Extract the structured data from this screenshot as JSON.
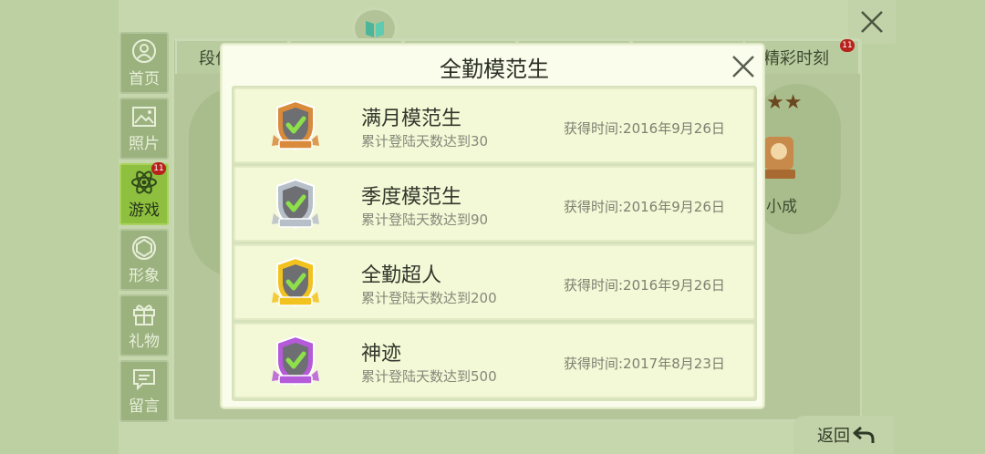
{
  "background": {
    "tabs": [
      "段位",
      "精彩时刻"
    ],
    "tab_badge": "11",
    "achievement_label": "小成"
  },
  "nav": {
    "items": [
      {
        "label": "首页",
        "icon": "home-icon"
      },
      {
        "label": "照片",
        "icon": "photo-icon"
      },
      {
        "label": "游戏",
        "icon": "atom-icon",
        "badge": "11"
      },
      {
        "label": "形象",
        "icon": "avatar-icon"
      },
      {
        "label": "礼物",
        "icon": "gift-icon"
      },
      {
        "label": "留言",
        "icon": "message-icon"
      }
    ]
  },
  "back_label": "返回",
  "modal": {
    "title": "全勤模范生",
    "items": [
      {
        "name": "满月模范生",
        "desc": "累计登陆天数达到30",
        "time": "获得时间:2016年9月26日",
        "medal_color": "#d98a3b"
      },
      {
        "name": "季度模范生",
        "desc": "累计登陆天数达到90",
        "time": "获得时间:2016年9月26日",
        "medal_color": "#b7bfc9"
      },
      {
        "name": "全勤超人",
        "desc": "累计登陆天数达到200",
        "time": "获得时间:2016年9月26日",
        "medal_color": "#f2c21e"
      },
      {
        "name": "神迹",
        "desc": "累计登陆天数达到500",
        "time": "获得时间:2017年8月23日",
        "medal_color": "#b55ad8"
      }
    ]
  }
}
